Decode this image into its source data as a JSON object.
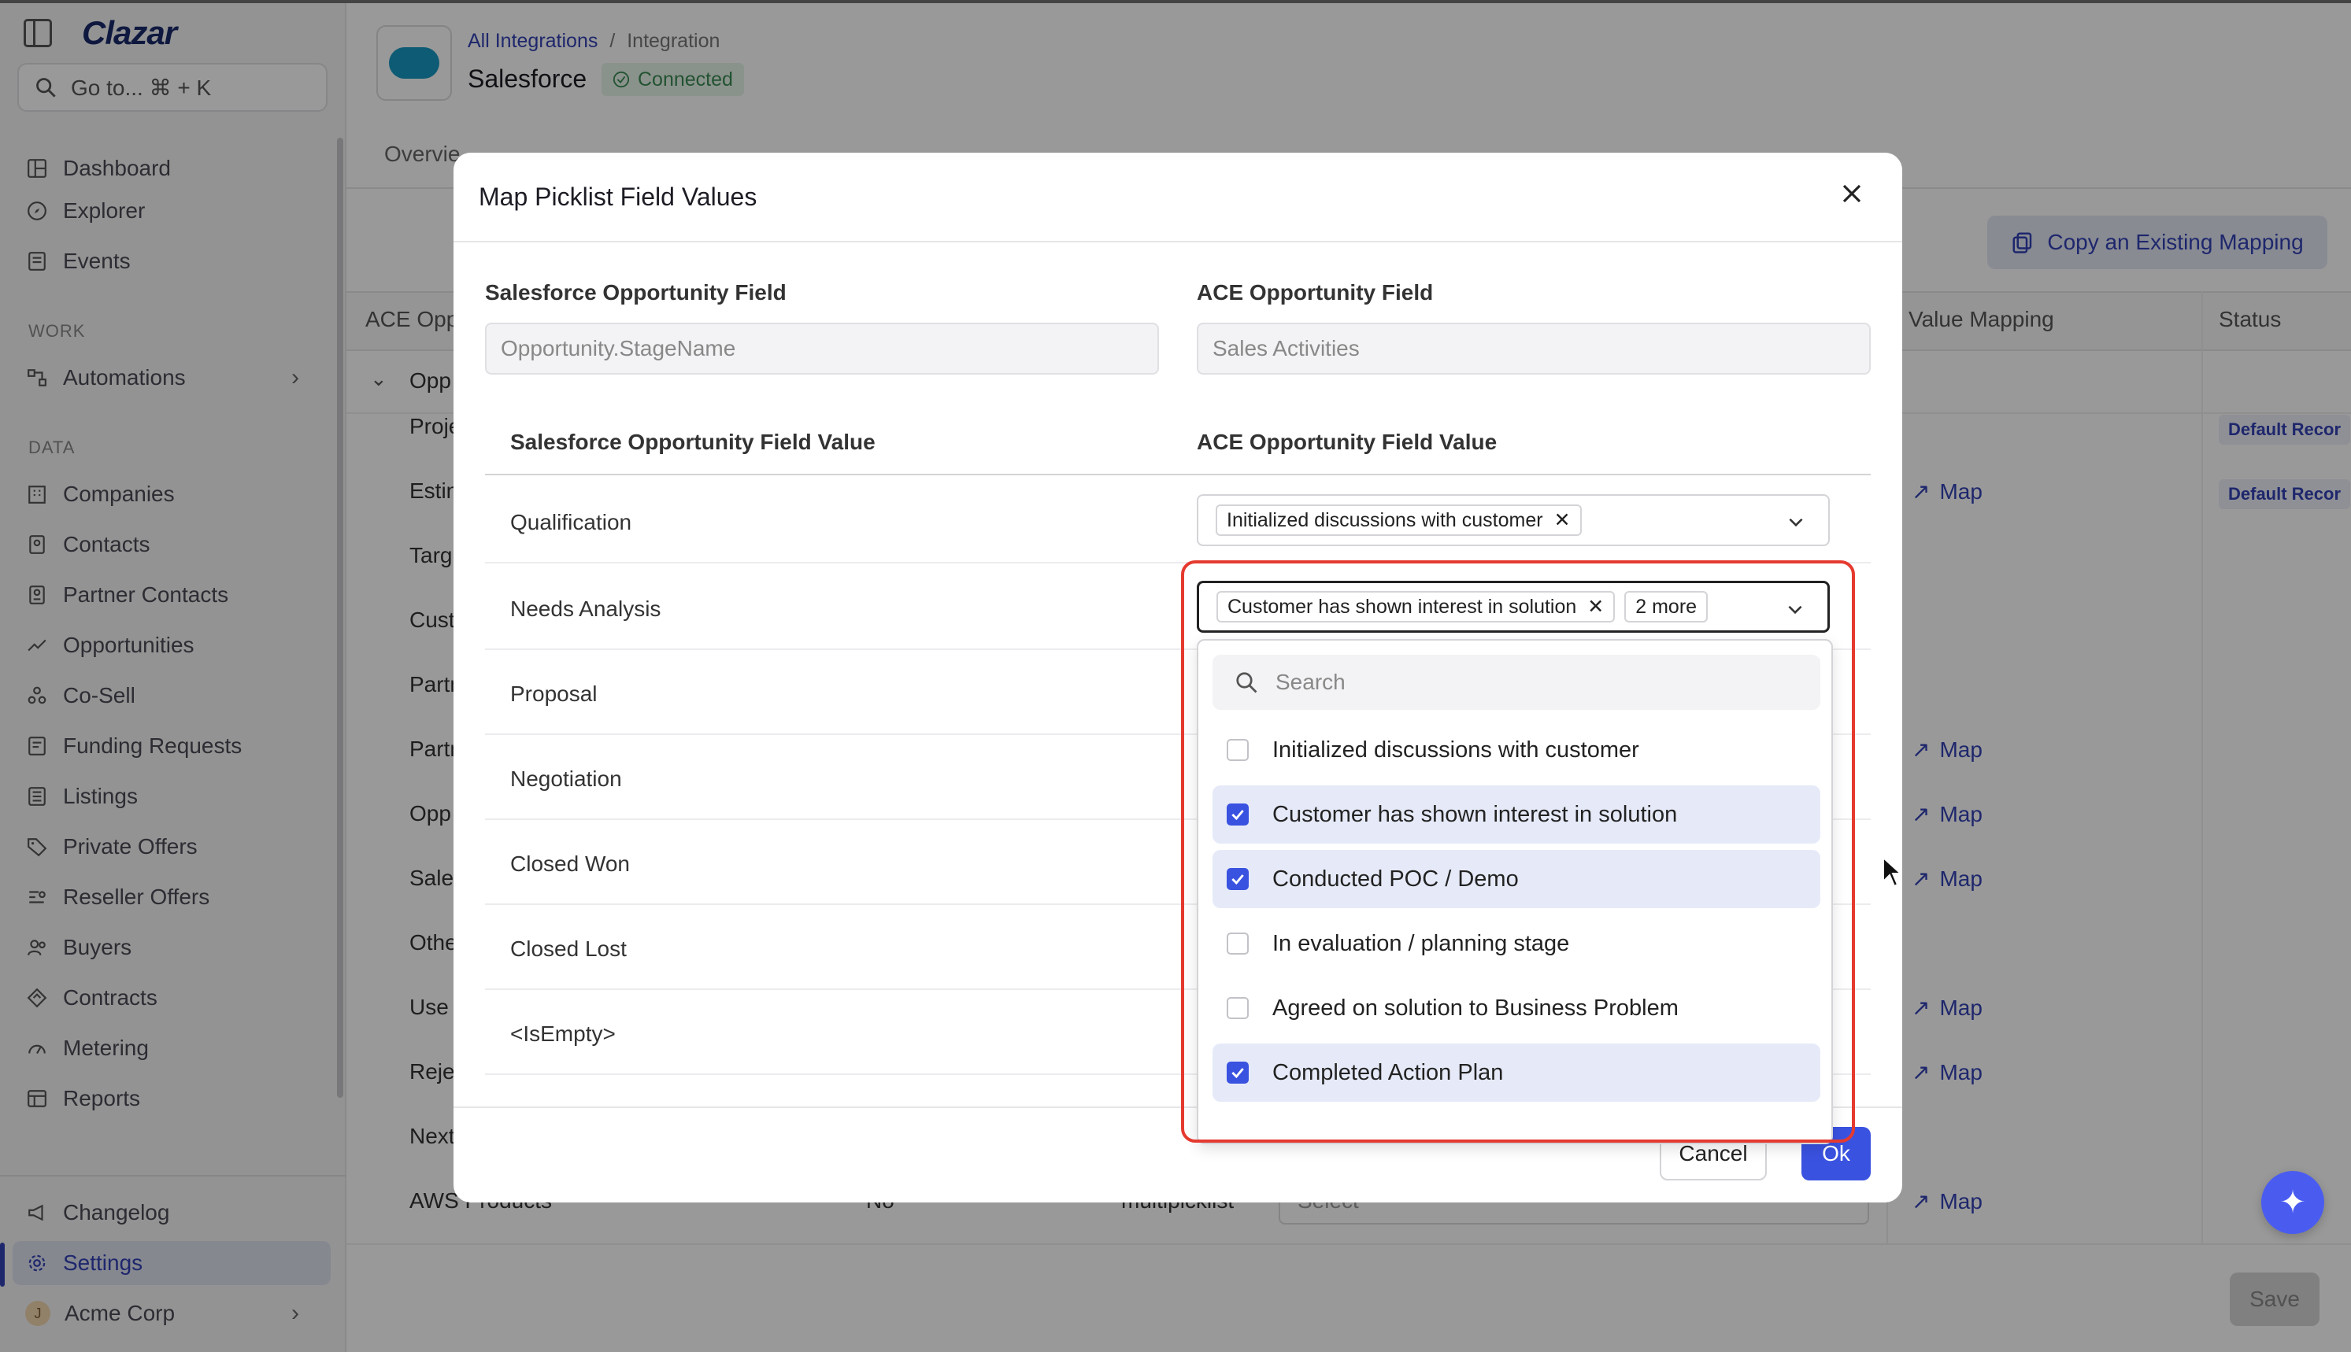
{
  "sidebar": {
    "brand": "Clazar",
    "goto_label": "Go to... ⌘ + K",
    "items_main": [
      {
        "label": "Dashboard",
        "icon": "dashboard-icon"
      },
      {
        "label": "Explorer",
        "icon": "compass-icon"
      },
      {
        "label": "Events",
        "icon": "list-icon"
      }
    ],
    "section_work": "WORK",
    "automations": "Automations",
    "section_data": "DATA",
    "items_data": [
      {
        "label": "Companies",
        "icon": "building-icon"
      },
      {
        "label": "Contacts",
        "icon": "contact-icon"
      },
      {
        "label": "Partner Contacts",
        "icon": "partner-contact-icon"
      },
      {
        "label": "Opportunities",
        "icon": "trend-icon"
      },
      {
        "label": "Co-Sell",
        "icon": "cosell-icon"
      },
      {
        "label": "Funding Requests",
        "icon": "funding-icon"
      },
      {
        "label": "Listings",
        "icon": "listings-icon"
      },
      {
        "label": "Private Offers",
        "icon": "tag-icon"
      },
      {
        "label": "Reseller Offers",
        "icon": "reseller-icon"
      },
      {
        "label": "Buyers",
        "icon": "users-icon"
      },
      {
        "label": "Contracts",
        "icon": "contract-icon"
      },
      {
        "label": "Metering",
        "icon": "meter-icon"
      },
      {
        "label": "Reports",
        "icon": "table-icon"
      }
    ],
    "changelog": "Changelog",
    "settings": "Settings",
    "org_initial": "J",
    "org_name": "Acme Corp"
  },
  "header": {
    "crumb_link": "All Integrations",
    "crumb_sep": "/",
    "crumb_current": "Integration",
    "title": "Salesforce",
    "status": "Connected"
  },
  "background": {
    "tab_partial": "Overvie",
    "copy_button": "Copy an Existing Mapping",
    "col_ace": "ACE Opp",
    "col_value_mapping": "Value Mapping",
    "col_status": "Status",
    "group_label": "Opp",
    "row_labels": [
      "Proje",
      "Estin",
      "Targ",
      "Cust",
      "Partn",
      "Partn",
      "Opp",
      "Sale",
      "Othe",
      "Use",
      "Reje",
      "Next",
      "AWS Products"
    ],
    "map_label": "Map",
    "default_badge": "Default Recor",
    "last_row_col2": "No",
    "last_row_col3": "multipicklist",
    "last_row_select": "Select",
    "save_button": "Save"
  },
  "modal": {
    "title": "Map Picklist Field Values",
    "sf_field_label": "Salesforce Opportunity Field",
    "sf_field_value": "Opportunity.StageName",
    "ace_field_label": "ACE Opportunity Field",
    "ace_field_value": "Sales Activities",
    "col_sf_value": "Salesforce Opportunity Field Value",
    "col_ace_value": "ACE Opportunity Field Value",
    "rows": [
      "Qualification",
      "Needs Analysis",
      "Proposal",
      "Negotiation",
      "Closed Won",
      "Closed Lost",
      "<IsEmpty>"
    ],
    "qualification_chip": "Initialized discussions with customer",
    "needs_chip": "Customer has shown interest in solution",
    "needs_more": "2 more",
    "cancel": "Cancel",
    "ok": "Ok"
  },
  "dropdown": {
    "search_placeholder": "Search",
    "options": [
      {
        "label": "Initialized discussions with customer",
        "checked": false
      },
      {
        "label": "Customer has shown interest in solution",
        "checked": true
      },
      {
        "label": "Conducted POC / Demo",
        "checked": true
      },
      {
        "label": "In evaluation / planning stage",
        "checked": false
      },
      {
        "label": "Agreed on solution to Business Problem",
        "checked": false
      },
      {
        "label": "Completed Action Plan",
        "checked": true
      }
    ]
  },
  "colors": {
    "accent": "#3a52e0",
    "highlight_border": "#e53a2f",
    "connected_green": "#3a8a52"
  }
}
